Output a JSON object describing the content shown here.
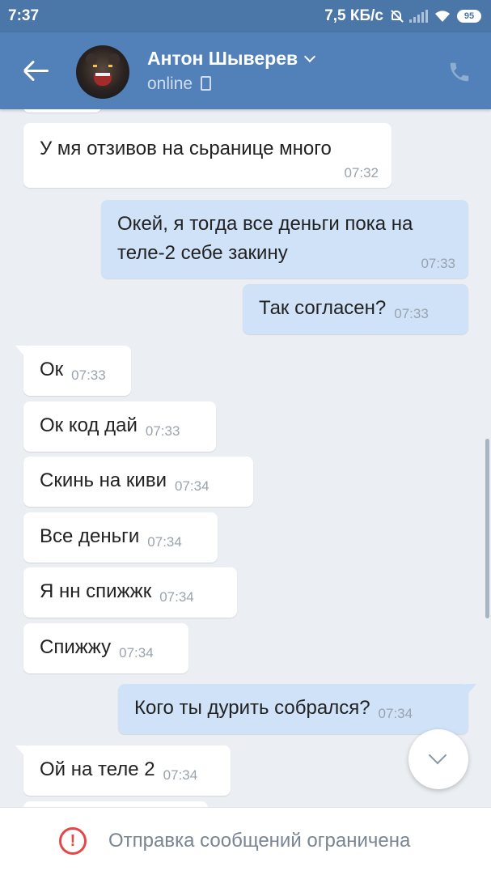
{
  "status_bar": {
    "time": "7:37",
    "network_speed": "7,5 КБ/с",
    "battery": "95",
    "icons": [
      "silent-bell-icon",
      "signal-icon",
      "wifi-icon",
      "battery-icon"
    ]
  },
  "header": {
    "contact_name": "Антон Шыверев",
    "status": "online",
    "icons": [
      "back-arrow-icon",
      "avatar-bear",
      "chevron-down-icon",
      "mobile-phone-icon",
      "phone-call-icon"
    ],
    "colors": {
      "bar": "#5181b8",
      "status_bar": "#4a76a8"
    }
  },
  "messages": [
    {
      "dir": "in",
      "text": "У мя отзивов на сьранице много",
      "time": "07:32"
    },
    {
      "dir": "out",
      "text": "Окей, я тогда все деньги пока на теле-2 себе закину",
      "time": "07:33"
    },
    {
      "dir": "out",
      "text": "Так согласен?",
      "time": "07:33"
    },
    {
      "dir": "in",
      "text": "Ок",
      "time": "07:33"
    },
    {
      "dir": "in",
      "text": "Ок код дай",
      "time": "07:33"
    },
    {
      "dir": "in",
      "text": "Скинь на киви",
      "time": "07:34"
    },
    {
      "dir": "in",
      "text": "Все деньги",
      "time": "07:34"
    },
    {
      "dir": "in",
      "text": "Я нн спижжк",
      "time": "07:34"
    },
    {
      "dir": "in",
      "text": "Спижжу",
      "time": "07:34"
    },
    {
      "dir": "out",
      "text": "Кого ты дурить собрался?",
      "time": "07:34"
    },
    {
      "dir": "in",
      "text": "Ой на теле 2",
      "time": "07:34"
    }
  ],
  "bottom_bar": {
    "restriction_text": "Отправка сообщений ограничена",
    "icon": "warning-circle-icon",
    "color": "#e64646"
  },
  "scroll_down_button": {
    "icon": "chevron-down-icon"
  }
}
